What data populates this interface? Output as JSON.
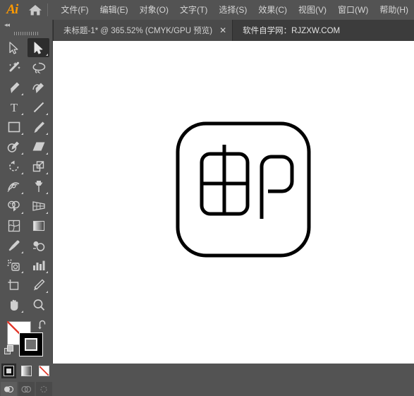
{
  "app": {
    "name": "Ai",
    "logo_icon": "illustrator-logo-icon",
    "home_icon": "home-icon"
  },
  "menubar": {
    "items": [
      {
        "label": "文件(F)",
        "name": "menu-file"
      },
      {
        "label": "编辑(E)",
        "name": "menu-edit"
      },
      {
        "label": "对象(O)",
        "name": "menu-object"
      },
      {
        "label": "文字(T)",
        "name": "menu-type"
      },
      {
        "label": "选择(S)",
        "name": "menu-select"
      },
      {
        "label": "效果(C)",
        "name": "menu-effect"
      },
      {
        "label": "视图(V)",
        "name": "menu-view"
      },
      {
        "label": "窗口(W)",
        "name": "menu-window"
      },
      {
        "label": "帮助(H)",
        "name": "menu-help"
      }
    ]
  },
  "tabbar": {
    "document_tab": {
      "title": "未标题-1* @ 365.52% (CMYK/GPU 预览)",
      "close_label": "✕"
    },
    "site_label": "软件自学网：RJZXW.COM"
  },
  "toolpanel": {
    "collapse_label": "◂◂",
    "tools": [
      {
        "name": "selection-tool",
        "icon": "arrow-outline-icon",
        "active": false,
        "has_flyout": false
      },
      {
        "name": "direct-selection-tool",
        "icon": "arrow-filled-icon",
        "active": true,
        "has_flyout": true
      },
      {
        "name": "magic-wand-tool",
        "icon": "magic-wand-icon",
        "active": false,
        "has_flyout": false
      },
      {
        "name": "lasso-tool",
        "icon": "lasso-icon",
        "active": false,
        "has_flyout": false
      },
      {
        "name": "pen-tool",
        "icon": "pen-icon",
        "active": false,
        "has_flyout": true
      },
      {
        "name": "curvature-tool",
        "icon": "curvature-pen-icon",
        "active": false,
        "has_flyout": false
      },
      {
        "name": "type-tool",
        "icon": "type-t-icon",
        "active": false,
        "has_flyout": true
      },
      {
        "name": "line-segment-tool",
        "icon": "line-diagonal-icon",
        "active": false,
        "has_flyout": true
      },
      {
        "name": "rectangle-tool",
        "icon": "rectangle-icon",
        "active": false,
        "has_flyout": true
      },
      {
        "name": "paintbrush-tool",
        "icon": "paintbrush-icon",
        "active": false,
        "has_flyout": true
      },
      {
        "name": "shaper-tool",
        "icon": "shaper-pencil-icon",
        "active": false,
        "has_flyout": true
      },
      {
        "name": "eraser-tool",
        "icon": "eraser-icon",
        "active": false,
        "has_flyout": true
      },
      {
        "name": "rotate-tool",
        "icon": "rotate-icon",
        "active": false,
        "has_flyout": true
      },
      {
        "name": "scale-tool",
        "icon": "scale-icon",
        "active": false,
        "has_flyout": true
      },
      {
        "name": "width-tool",
        "icon": "width-warp-icon",
        "active": false,
        "has_flyout": true
      },
      {
        "name": "free-transform-tool",
        "icon": "pushpin-icon",
        "active": false,
        "has_flyout": true
      },
      {
        "name": "shape-builder-tool",
        "icon": "shape-builder-icon",
        "active": false,
        "has_flyout": true
      },
      {
        "name": "perspective-grid-tool",
        "icon": "perspective-grid-icon",
        "active": false,
        "has_flyout": true
      },
      {
        "name": "mesh-tool",
        "icon": "mesh-icon",
        "active": false,
        "has_flyout": false
      },
      {
        "name": "gradient-tool",
        "icon": "gradient-icon",
        "active": false,
        "has_flyout": false
      },
      {
        "name": "eyedropper-tool",
        "icon": "eyedropper-icon",
        "active": false,
        "has_flyout": true
      },
      {
        "name": "blend-tool",
        "icon": "blend-icon",
        "active": false,
        "has_flyout": false
      },
      {
        "name": "symbol-sprayer-tool",
        "icon": "symbol-sprayer-icon",
        "active": false,
        "has_flyout": true
      },
      {
        "name": "column-graph-tool",
        "icon": "bar-chart-icon",
        "active": false,
        "has_flyout": true
      },
      {
        "name": "artboard-tool",
        "icon": "artboard-icon",
        "active": false,
        "has_flyout": false
      },
      {
        "name": "slice-tool",
        "icon": "slice-knife-icon",
        "active": false,
        "has_flyout": true
      },
      {
        "name": "hand-tool",
        "icon": "hand-icon",
        "active": false,
        "has_flyout": true
      },
      {
        "name": "zoom-tool",
        "icon": "magnifier-icon",
        "active": false,
        "has_flyout": false
      }
    ],
    "color_controls": {
      "fill_swatch": {
        "name": "fill-swatch",
        "value": "none"
      },
      "stroke_swatch": {
        "name": "stroke-swatch",
        "value": "#000000"
      },
      "swap_icon": "swap-fill-stroke-icon",
      "default_icon": "default-fill-stroke-icon"
    },
    "fill_modes": [
      {
        "name": "color-mode-button",
        "icon": "solid-color-icon",
        "selected": true
      },
      {
        "name": "gradient-mode-button",
        "icon": "gradient-swatch-icon",
        "selected": false
      },
      {
        "name": "none-mode-button",
        "icon": "none-swatch-icon",
        "selected": false
      }
    ],
    "draw_modes": [
      {
        "name": "draw-normal-button",
        "icon": "draw-normal-icon",
        "selected": true
      },
      {
        "name": "draw-behind-button",
        "icon": "draw-behind-icon",
        "selected": false
      },
      {
        "name": "draw-inside-button",
        "icon": "draw-inside-icon",
        "selected": false
      }
    ]
  },
  "canvas": {
    "artwork_name": "rounded-square-logo-artwork",
    "description": "黑色描边圆角方框内含中字与P字母图形",
    "stroke_color": "#000000",
    "fill_color": "none",
    "zoom_percent": "365.52%"
  },
  "colors": {
    "chrome_bg": "#535353",
    "tab_bg": "#3c3c3c",
    "tab_active_bg": "#4a4a4a",
    "canvas_bg": "#ffffff",
    "accent_orange": "#ff9a00",
    "text": "#d6d6d6",
    "artwork_stroke": "#000000"
  }
}
